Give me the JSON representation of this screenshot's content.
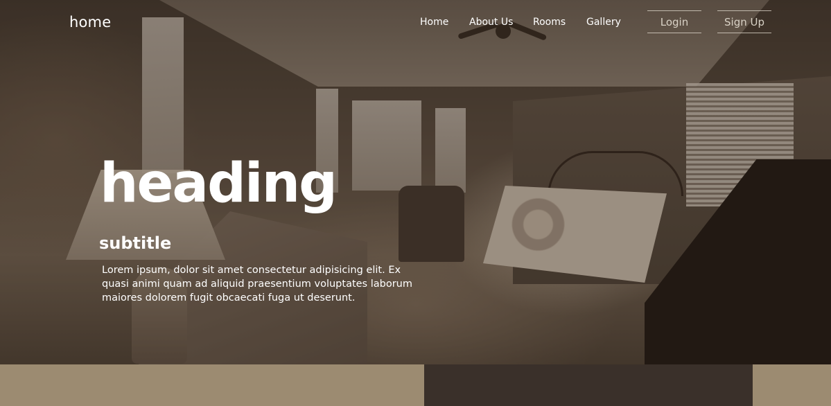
{
  "brand": {
    "name": "home"
  },
  "nav": {
    "items": [
      {
        "label": "Home"
      },
      {
        "label": "About Us"
      },
      {
        "label": "Rooms"
      },
      {
        "label": "Gallery"
      }
    ],
    "login_label": "Login",
    "signup_label": "Sign Up"
  },
  "hero": {
    "heading": "heading",
    "subtitle": "subtitle",
    "body": "Lorem ipsum, dolor sit amet consectetur adipisicing elit. Ex quasi animi quam ad aliquid praesentium voluptates laborum maiores dolorem fugit obcaecati fuga ut deserunt."
  },
  "colors": {
    "band_tan": "#9c8b71",
    "band_dark": "#3a302a",
    "text": "#ffffff"
  }
}
